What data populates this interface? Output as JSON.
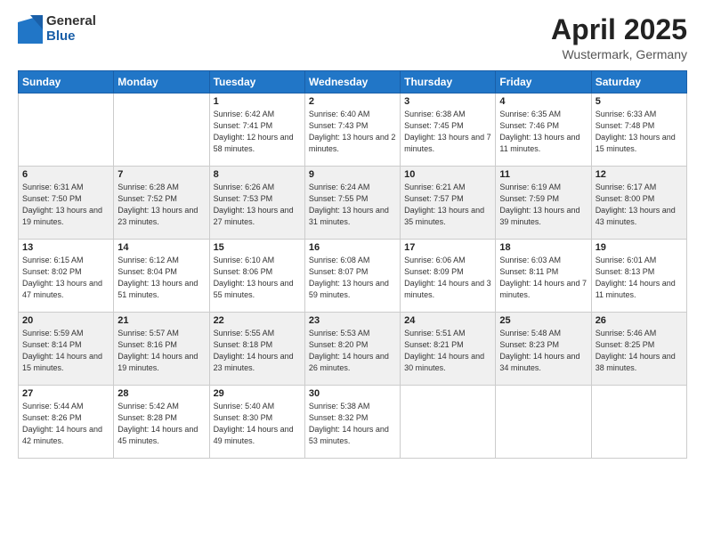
{
  "header": {
    "logo_general": "General",
    "logo_blue": "Blue",
    "title": "April 2025",
    "subtitle": "Wustermark, Germany"
  },
  "weekdays": [
    "Sunday",
    "Monday",
    "Tuesday",
    "Wednesday",
    "Thursday",
    "Friday",
    "Saturday"
  ],
  "weeks": [
    [
      {
        "day": "",
        "info": ""
      },
      {
        "day": "",
        "info": ""
      },
      {
        "day": "1",
        "info": "Sunrise: 6:42 AM\nSunset: 7:41 PM\nDaylight: 12 hours and 58 minutes."
      },
      {
        "day": "2",
        "info": "Sunrise: 6:40 AM\nSunset: 7:43 PM\nDaylight: 13 hours and 2 minutes."
      },
      {
        "day": "3",
        "info": "Sunrise: 6:38 AM\nSunset: 7:45 PM\nDaylight: 13 hours and 7 minutes."
      },
      {
        "day": "4",
        "info": "Sunrise: 6:35 AM\nSunset: 7:46 PM\nDaylight: 13 hours and 11 minutes."
      },
      {
        "day": "5",
        "info": "Sunrise: 6:33 AM\nSunset: 7:48 PM\nDaylight: 13 hours and 15 minutes."
      }
    ],
    [
      {
        "day": "6",
        "info": "Sunrise: 6:31 AM\nSunset: 7:50 PM\nDaylight: 13 hours and 19 minutes."
      },
      {
        "day": "7",
        "info": "Sunrise: 6:28 AM\nSunset: 7:52 PM\nDaylight: 13 hours and 23 minutes."
      },
      {
        "day": "8",
        "info": "Sunrise: 6:26 AM\nSunset: 7:53 PM\nDaylight: 13 hours and 27 minutes."
      },
      {
        "day": "9",
        "info": "Sunrise: 6:24 AM\nSunset: 7:55 PM\nDaylight: 13 hours and 31 minutes."
      },
      {
        "day": "10",
        "info": "Sunrise: 6:21 AM\nSunset: 7:57 PM\nDaylight: 13 hours and 35 minutes."
      },
      {
        "day": "11",
        "info": "Sunrise: 6:19 AM\nSunset: 7:59 PM\nDaylight: 13 hours and 39 minutes."
      },
      {
        "day": "12",
        "info": "Sunrise: 6:17 AM\nSunset: 8:00 PM\nDaylight: 13 hours and 43 minutes."
      }
    ],
    [
      {
        "day": "13",
        "info": "Sunrise: 6:15 AM\nSunset: 8:02 PM\nDaylight: 13 hours and 47 minutes."
      },
      {
        "day": "14",
        "info": "Sunrise: 6:12 AM\nSunset: 8:04 PM\nDaylight: 13 hours and 51 minutes."
      },
      {
        "day": "15",
        "info": "Sunrise: 6:10 AM\nSunset: 8:06 PM\nDaylight: 13 hours and 55 minutes."
      },
      {
        "day": "16",
        "info": "Sunrise: 6:08 AM\nSunset: 8:07 PM\nDaylight: 13 hours and 59 minutes."
      },
      {
        "day": "17",
        "info": "Sunrise: 6:06 AM\nSunset: 8:09 PM\nDaylight: 14 hours and 3 minutes."
      },
      {
        "day": "18",
        "info": "Sunrise: 6:03 AM\nSunset: 8:11 PM\nDaylight: 14 hours and 7 minutes."
      },
      {
        "day": "19",
        "info": "Sunrise: 6:01 AM\nSunset: 8:13 PM\nDaylight: 14 hours and 11 minutes."
      }
    ],
    [
      {
        "day": "20",
        "info": "Sunrise: 5:59 AM\nSunset: 8:14 PM\nDaylight: 14 hours and 15 minutes."
      },
      {
        "day": "21",
        "info": "Sunrise: 5:57 AM\nSunset: 8:16 PM\nDaylight: 14 hours and 19 minutes."
      },
      {
        "day": "22",
        "info": "Sunrise: 5:55 AM\nSunset: 8:18 PM\nDaylight: 14 hours and 23 minutes."
      },
      {
        "day": "23",
        "info": "Sunrise: 5:53 AM\nSunset: 8:20 PM\nDaylight: 14 hours and 26 minutes."
      },
      {
        "day": "24",
        "info": "Sunrise: 5:51 AM\nSunset: 8:21 PM\nDaylight: 14 hours and 30 minutes."
      },
      {
        "day": "25",
        "info": "Sunrise: 5:48 AM\nSunset: 8:23 PM\nDaylight: 14 hours and 34 minutes."
      },
      {
        "day": "26",
        "info": "Sunrise: 5:46 AM\nSunset: 8:25 PM\nDaylight: 14 hours and 38 minutes."
      }
    ],
    [
      {
        "day": "27",
        "info": "Sunrise: 5:44 AM\nSunset: 8:26 PM\nDaylight: 14 hours and 42 minutes."
      },
      {
        "day": "28",
        "info": "Sunrise: 5:42 AM\nSunset: 8:28 PM\nDaylight: 14 hours and 45 minutes."
      },
      {
        "day": "29",
        "info": "Sunrise: 5:40 AM\nSunset: 8:30 PM\nDaylight: 14 hours and 49 minutes."
      },
      {
        "day": "30",
        "info": "Sunrise: 5:38 AM\nSunset: 8:32 PM\nDaylight: 14 hours and 53 minutes."
      },
      {
        "day": "",
        "info": ""
      },
      {
        "day": "",
        "info": ""
      },
      {
        "day": "",
        "info": ""
      }
    ]
  ]
}
